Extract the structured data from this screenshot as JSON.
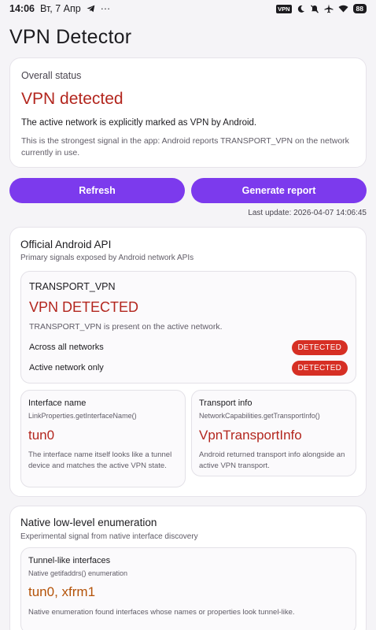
{
  "status_bar": {
    "time": "14:06",
    "date": "Вт, 7 Апр",
    "telegram_icon": "telegram-icon",
    "more": "···",
    "vpn_badge": "VPN",
    "battery": "88"
  },
  "app": {
    "title": "VPN Detector"
  },
  "overall": {
    "label": "Overall status",
    "status": "VPN detected",
    "summary": "The active network is explicitly marked as VPN by Android.",
    "detail": "This is the strongest signal in the app: Android reports TRANSPORT_VPN on the network currently in use."
  },
  "actions": {
    "refresh_label": "Refresh",
    "report_label": "Generate report",
    "last_update": "Last update: 2026-04-07 14:06:45"
  },
  "official_api": {
    "title": "Official Android API",
    "subtitle": "Primary signals exposed by Android network APIs",
    "transport_vpn": {
      "name": "TRANSPORT_VPN",
      "status": "VPN DETECTED",
      "description": "TRANSPORT_VPN is present on the active network.",
      "rows": [
        {
          "label": "Across all networks",
          "badge": "DETECTED"
        },
        {
          "label": "Active network only",
          "badge": "DETECTED"
        }
      ]
    },
    "interface_name": {
      "title": "Interface name",
      "api": "LinkProperties.getInterfaceName()",
      "value": "tun0",
      "description": "The interface name itself looks like a tunnel device and matches the active VPN state."
    },
    "transport_info": {
      "title": "Transport info",
      "api": "NetworkCapabilities.getTransportInfo()",
      "value": "VpnTransportInfo",
      "description": "Android returned transport info alongside an active VPN transport."
    }
  },
  "native": {
    "title": "Native low-level enumeration",
    "subtitle": "Experimental signal from native interface discovery",
    "tunnel": {
      "title": "Tunnel-like interfaces",
      "api": "Native getifaddrs() enumeration",
      "value": "tun0, xfrm1",
      "description": "Native enumeration found interfaces whose names or properties look tunnel-like."
    }
  },
  "colors": {
    "accent": "#7c3aed",
    "danger_text": "#b3261e",
    "danger_badge": "#d62f24",
    "warning_text": "#b45309"
  }
}
